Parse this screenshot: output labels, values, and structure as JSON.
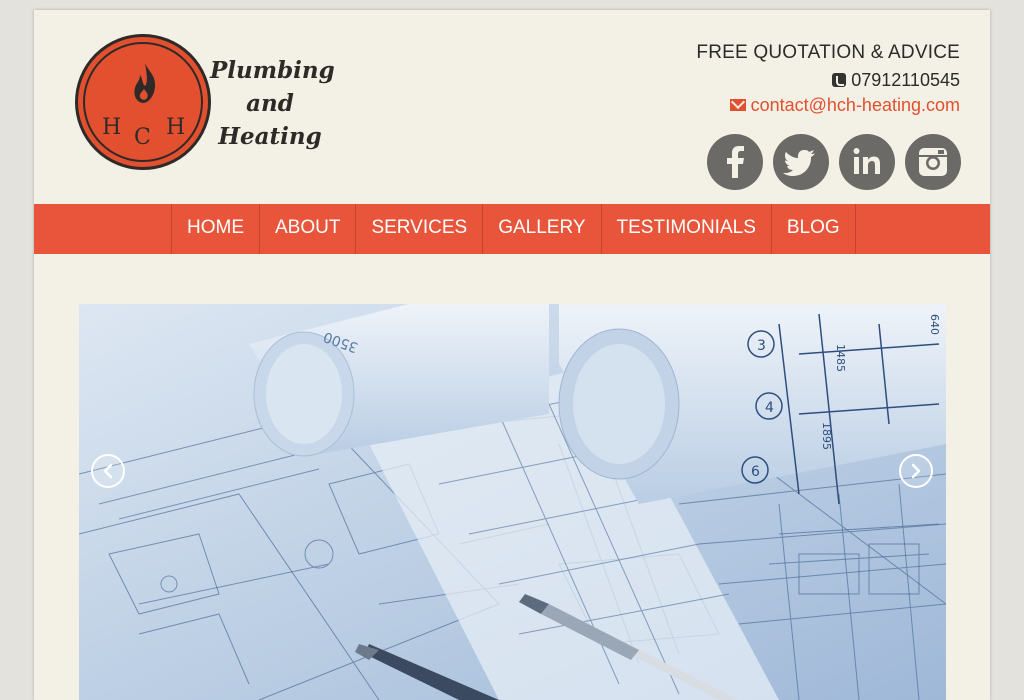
{
  "brand": {
    "logo_letters": [
      "H",
      "C",
      "H"
    ],
    "title_lines": [
      "Plumbing",
      "and",
      "Heating"
    ]
  },
  "contact": {
    "tagline": "FREE QUOTATION & ADVICE",
    "phone": "07912110545",
    "email": "contact@hch-heating.com",
    "phone_icon": "phone-icon",
    "email_icon": "envelope-icon"
  },
  "social": [
    {
      "name": "facebook-icon"
    },
    {
      "name": "twitter-icon"
    },
    {
      "name": "linkedin-icon"
    },
    {
      "name": "instagram-icon"
    }
  ],
  "nav": {
    "items": [
      "HOME",
      "ABOUT",
      "SERVICES",
      "GALLERY",
      "TESTIMONIALS",
      "BLOG"
    ]
  },
  "slider": {
    "prev_icon": "chevron-left-icon",
    "next_icon": "chevron-right-icon",
    "blueprint_labels": [
      "1485",
      "1895",
      "3",
      "4",
      "6",
      "3500",
      "640"
    ]
  },
  "colors": {
    "accent": "#e8553b",
    "logo_red": "#e2502f",
    "page_bg": "#f3f0e5",
    "social_gray": "#6c6a66",
    "text_dark": "#2b2b2b"
  }
}
